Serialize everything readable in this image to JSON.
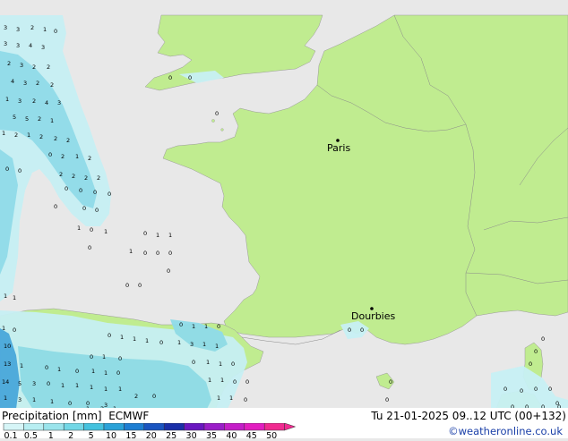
{
  "cities": [
    {
      "name": "Paris",
      "id": "paris"
    },
    {
      "name": "Dourbies",
      "id": "dourbies"
    }
  ],
  "legend": {
    "title": "Precipitation [mm]",
    "model": "ECMWF",
    "scale_labels": [
      "0.1",
      "0.5",
      "1",
      "2",
      "5",
      "10",
      "15",
      "20",
      "25",
      "30",
      "35",
      "40",
      "45",
      "50"
    ],
    "scale_colors": [
      "#d6f5f7",
      "#b8eef2",
      "#9ae4ec",
      "#72d7e6",
      "#44c2de",
      "#2aa2d8",
      "#1e7ed2",
      "#1a55c0",
      "#1a2fa8",
      "#6a17c0",
      "#9a1ec8",
      "#c41ec8",
      "#e21ec0",
      "#f02a90"
    ]
  },
  "valid_time": "Tu 21-01-2025 09..12 UTC (00+132)",
  "copyright": "©weatheronline.co.uk",
  "colors": {
    "land": "#c0ec90",
    "sea": "#e8e8e8",
    "precip_light": "#c7f0f4",
    "precip_mid": "#8fdcea",
    "precip_heavy": "#4aa8e0"
  }
}
